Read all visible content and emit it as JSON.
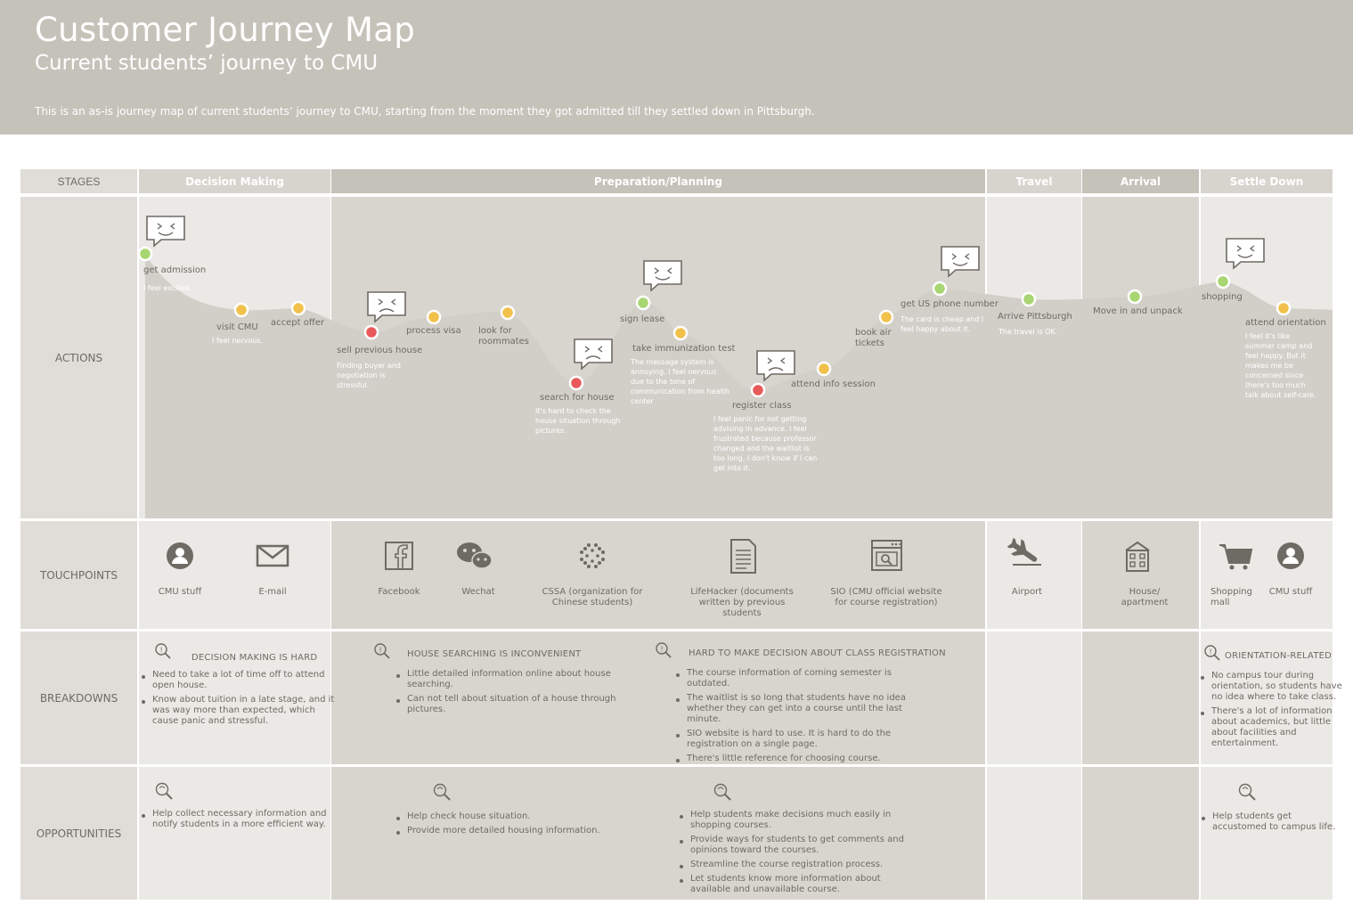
{
  "header": {
    "title": "Customer Journey Map",
    "subtitle": "Current students’ journey to CMU",
    "description": "This is an as-is journey map of current students’ journey to CMU, starting from the moment they got admitted till they settled down in Pittsburgh."
  },
  "rows": {
    "stages": "STAGES",
    "actions": "ACTIONS",
    "touchpoints": "TOUCHPOINTS",
    "breakdowns": "BREAKDOWNS",
    "opportunities": "OPPORTUNITIES"
  },
  "stages": [
    "Decision Making",
    "Preparation/Planning",
    "Travel",
    "Arrival",
    "Settle Down"
  ],
  "colors": {
    "positive": "#a8d672",
    "neutral": "#f1c14b",
    "negative": "#e85a5a",
    "header_bg": "#c5c2ba",
    "curve_fill": "#d5d2cc"
  },
  "actions": [
    {
      "label": "get admission",
      "note": "I feel excited.",
      "mood": "positive"
    },
    {
      "label": "visit CMU",
      "note": "I feel nervous.",
      "mood": "neutral"
    },
    {
      "label": "accept offer",
      "note": "",
      "mood": "neutral"
    },
    {
      "label": "sell previous house",
      "note": "Finding buyer and negotiation is stressful.",
      "mood": "negative"
    },
    {
      "label": "process visa",
      "note": "",
      "mood": "neutral"
    },
    {
      "label": "look for roommates",
      "note": "",
      "mood": "neutral"
    },
    {
      "label": "search for house",
      "note": "It's hard to check the house situation through pictures.",
      "mood": "negative"
    },
    {
      "label": "sign lease",
      "note": "",
      "mood": "positive"
    },
    {
      "label": "take immunization test",
      "note": "The message system is annoying. I feel nervous due to the tone of communication from health center",
      "mood": "neutral"
    },
    {
      "label": "register class",
      "note": "I feel panic for not getting advising in advance. I feel frustrated because professor changed and the waitlist is too long, I don't know if I can get into it.",
      "mood": "negative"
    },
    {
      "label": "attend info session",
      "note": "",
      "mood": "neutral"
    },
    {
      "label": "book air tickets",
      "note": "",
      "mood": "neutral"
    },
    {
      "label": "get US phone number",
      "note": "The card is cheap and I feel happy about it.",
      "mood": "positive"
    },
    {
      "label": "Arrive Pittsburgh",
      "note": "The travel is OK.",
      "mood": "positive"
    },
    {
      "label": "Move in and unpack",
      "note": "",
      "mood": "positive"
    },
    {
      "label": "shopping",
      "note": "",
      "mood": "positive"
    },
    {
      "label": "attend orientation",
      "note": "I feel it's like summer camp and feel happy. But it makes me be concerned since there's too much talk about self-care.",
      "mood": "neutral"
    }
  ],
  "touchpoints": [
    {
      "label": "CMU stuff",
      "icon": "person-icon"
    },
    {
      "label": "E-mail",
      "icon": "mail-icon"
    },
    {
      "label": "Facebook",
      "icon": "facebook-icon"
    },
    {
      "label": "Wechat",
      "icon": "wechat-icon"
    },
    {
      "label": "CSSA (organization for Chinese students)",
      "icon": "cssa-icon"
    },
    {
      "label": "LifeHacker (documents written by previous students",
      "icon": "document-icon"
    },
    {
      "label": "SIO (CMU official website for course registration)",
      "icon": "website-icon"
    },
    {
      "label": "Airport",
      "icon": "airplane-icon"
    },
    {
      "label": "House/ apartment",
      "icon": "building-icon"
    },
    {
      "label": "Shopping mall",
      "icon": "cart-icon"
    },
    {
      "label": "CMU stuff",
      "icon": "person-icon"
    }
  ],
  "breakdowns": [
    {
      "title": "DECISION MAKING IS HARD",
      "items": [
        "Need to take a lot of time off to attend open house.",
        "Know about tuition in a late stage, and it was way more than expected, which cause panic and stressful."
      ]
    },
    {
      "title": "HOUSE SEARCHING IS INCONVENIENT",
      "items": [
        "Little detailed information online about house searching.",
        "Can not tell about situation of a house through pictures."
      ]
    },
    {
      "title": "HARD TO MAKE DECISION ABOUT CLASS REGISTRATION",
      "items": [
        "The course information of coming semester is outdated.",
        "The waitlist is so long that students have no idea whether they can get into a course until the last minute.",
        "SIO website is hard to use. It is hard to do the registration on a single page.",
        "There's little reference for choosing course."
      ]
    },
    {
      "title": "ORIENTATION-RELATED",
      "items": [
        "No campus tour during orientation, so students have no idea where to take class.",
        "There's a lot of information about academics, but little about facilities and entertainment."
      ]
    }
  ],
  "opportunities": [
    {
      "items": [
        "Help collect necessary information and notify students in a more efficient way."
      ]
    },
    {
      "items": [
        "Help check house situation.",
        "Provide more detailed housing information."
      ]
    },
    {
      "items": [
        "Help students make decisions much easily in shopping courses.",
        "Provide ways for students to get comments and opinions toward the courses.",
        "Streamline the course registration process.",
        "Let students know more information about available and unavailable course."
      ]
    },
    {
      "items": [
        "Help students get accustomed to campus life."
      ]
    }
  ]
}
